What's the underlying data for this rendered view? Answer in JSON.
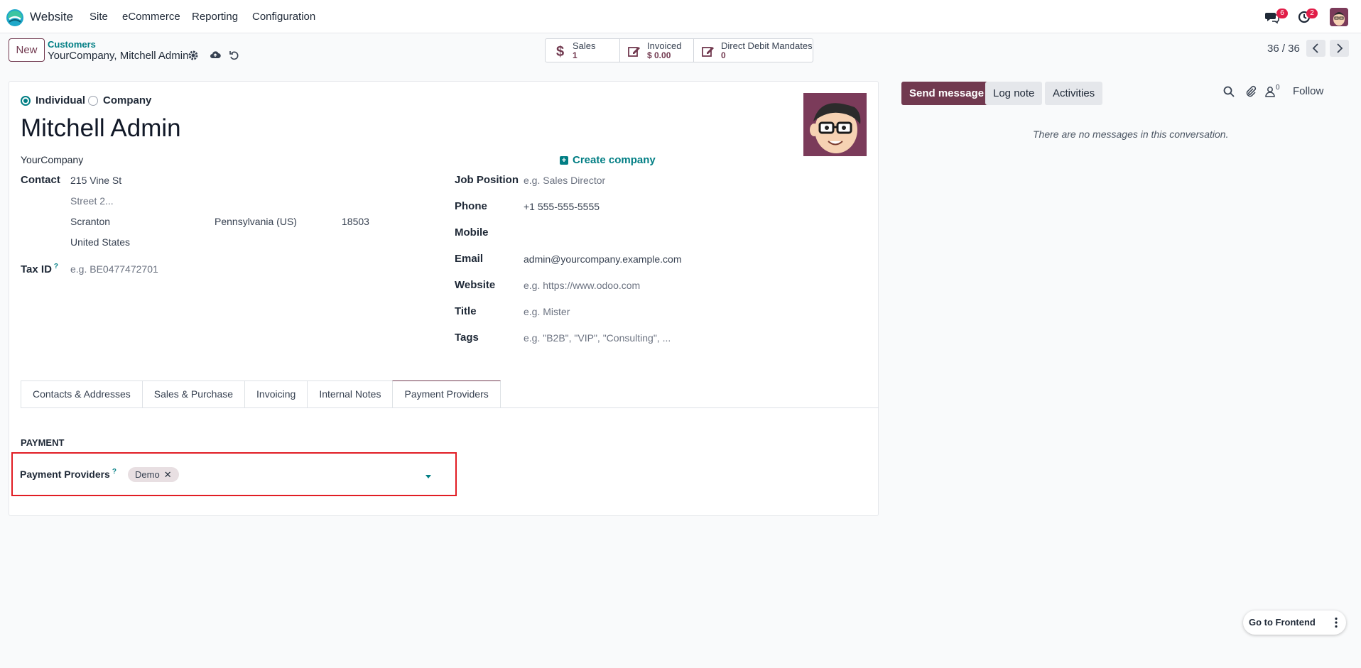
{
  "topnav": {
    "app_name": "Website",
    "menus": [
      "Site",
      "eCommerce",
      "Reporting",
      "Configuration"
    ],
    "messages_badge": "6",
    "activities_badge": "2"
  },
  "control_panel": {
    "new_label": "New",
    "breadcrumb_parent": "Customers",
    "breadcrumb_current": "YourCompany, Mitchell Admin",
    "pager": "36 / 36"
  },
  "smart_buttons": [
    {
      "label": "Sales",
      "value": "1",
      "icon": "dollar-icon"
    },
    {
      "label": "Invoiced",
      "value": "$ 0.00",
      "icon": "pencil-square-icon"
    },
    {
      "label": "Direct Debit Mandates",
      "value": "0",
      "icon": "pencil-square-icon"
    }
  ],
  "form": {
    "type_individual": "Individual",
    "type_company": "Company",
    "name": "Mitchell Admin",
    "company": "YourCompany",
    "create_company": "Create company",
    "contact_label": "Contact",
    "street": "215 Vine St",
    "street2_placeholder": "Street 2...",
    "city": "Scranton",
    "state": "Pennsylvania (US)",
    "zip": "18503",
    "country": "United States",
    "tax_id_label": "Tax ID",
    "tax_id_placeholder": "e.g. BE0477472701",
    "job_position_label": "Job Position",
    "job_position_placeholder": "e.g. Sales Director",
    "phone_label": "Phone",
    "phone": "+1 555-555-5555",
    "mobile_label": "Mobile",
    "email_label": "Email",
    "email": "admin@yourcompany.example.com",
    "website_label": "Website",
    "website_placeholder": "e.g. https://www.odoo.com",
    "title_label": "Title",
    "title_placeholder": "e.g. Mister",
    "tags_label": "Tags",
    "tags_placeholder": "e.g. \"B2B\", \"VIP\", \"Consulting\", ..."
  },
  "tabs": [
    "Contacts & Addresses",
    "Sales & Purchase",
    "Invoicing",
    "Internal Notes",
    "Payment Providers"
  ],
  "payment": {
    "section_title": "PAYMENT",
    "providers_label": "Payment Providers",
    "tag": "Demo"
  },
  "chatter": {
    "send_message": "Send message",
    "log_note": "Log note",
    "activities": "Activities",
    "followers_count": "0",
    "follow": "Follow",
    "empty": "There are no messages in this conversation."
  },
  "floating": {
    "go_to_frontend": "Go to Frontend"
  },
  "colors": {
    "brand": "#71394f",
    "accent": "#017e84",
    "highlight": "#e11d24"
  }
}
